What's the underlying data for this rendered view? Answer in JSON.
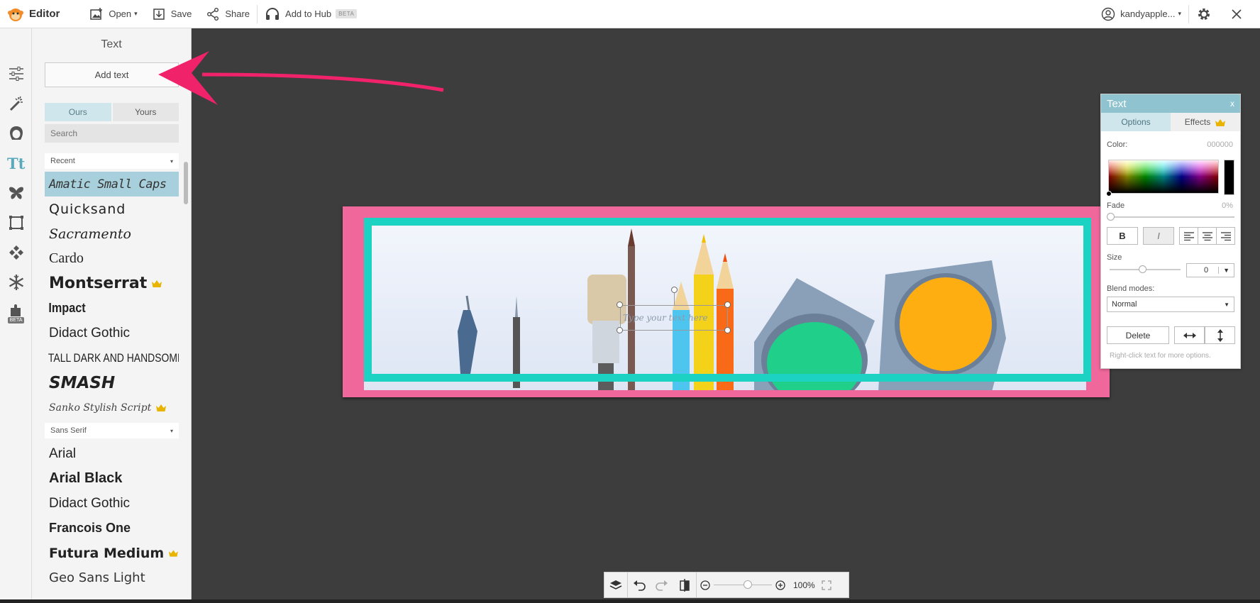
{
  "topbar": {
    "brand": "Editor",
    "open": "Open",
    "save": "Save",
    "share": "Share",
    "add_to_hub": "Add to Hub",
    "beta": "BETA",
    "user": "kandyapple..."
  },
  "left_icons": {
    "beta": "BETA"
  },
  "panel": {
    "title": "Text",
    "add_text": "Add text",
    "tabs": {
      "ours": "Ours",
      "yours": "Yours"
    },
    "search_placeholder": "Search",
    "category_recent": "Recent",
    "recent_fonts": [
      {
        "name": "Amatic Small Caps",
        "crown": false,
        "selected": true
      },
      {
        "name": "Quicksand",
        "crown": false
      },
      {
        "name": "Sacramento",
        "crown": false
      },
      {
        "name": "Cardo",
        "crown": false
      },
      {
        "name": "Montserrat",
        "crown": true
      },
      {
        "name": "Impact",
        "crown": false
      },
      {
        "name": "Didact Gothic",
        "crown": false
      },
      {
        "name": "Tall Dark and Handsome",
        "crown": false
      },
      {
        "name": "SMASH",
        "crown": false
      },
      {
        "name": "Sanko Stylish Script",
        "crown": true
      }
    ],
    "category_sans": "Sans Serif",
    "sans_fonts": [
      {
        "name": "Arial",
        "crown": false
      },
      {
        "name": "Arial Black",
        "crown": false
      },
      {
        "name": "Didact Gothic",
        "crown": false
      },
      {
        "name": "Francois One",
        "crown": false
      },
      {
        "name": "Futura Medium",
        "crown": true
      },
      {
        "name": "Geo Sans Light",
        "crown": false
      }
    ]
  },
  "canvas": {
    "placeholder_text": "Type your text here"
  },
  "text_panel": {
    "title": "Text",
    "close": "x",
    "tab_options": "Options",
    "tab_effects": "Effects",
    "color_label": "Color:",
    "color_value": "000000",
    "fade_label": "Fade",
    "fade_value": "0%",
    "bold": "B",
    "italic": "I",
    "size_label": "Size",
    "size_value": "0",
    "blend_label": "Blend modes:",
    "blend_value": "Normal",
    "delete": "Delete",
    "hint": "Right-click text for more options."
  },
  "zoom": {
    "value": "100%"
  },
  "colors": {
    "accent": "#8ec3cf",
    "frame_pink": "#f0679b",
    "frame_teal": "#1cd3c3",
    "arrow": "#f0226a",
    "crown": "#e8b400"
  }
}
